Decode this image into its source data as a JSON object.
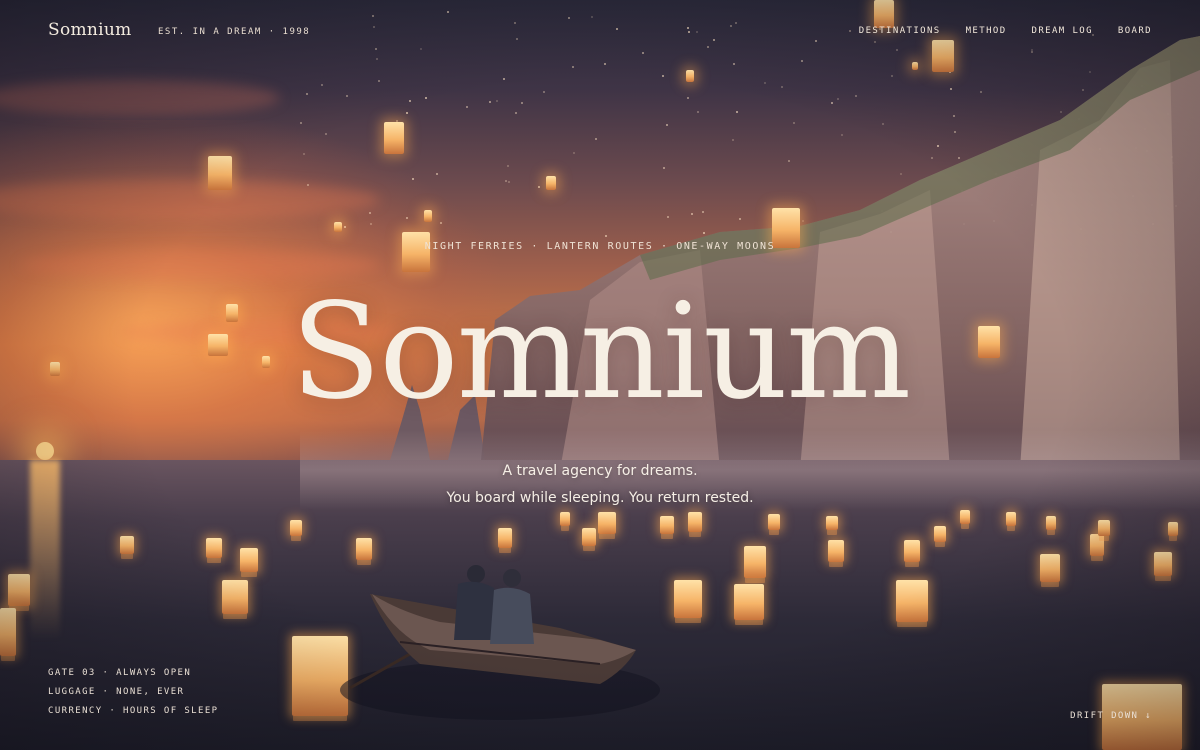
{
  "header": {
    "brand": "Somnium",
    "established": "EST. IN A DREAM · 1998",
    "nav": [
      "DESTINATIONS",
      "METHOD",
      "DREAM LOG",
      "BOARD"
    ]
  },
  "hero": {
    "kicker": "NIGHT FERRIES · LANTERN ROUTES · ONE-WAY MOONS",
    "title": "Somnium",
    "tagline_line1": "A travel agency for dreams.",
    "tagline_line2": "You board while sleeping. You return rested."
  },
  "info": {
    "gate": "GATE 03 · ALWAYS OPEN",
    "luggage": "LUGGAGE · NONE, EVER",
    "currency": "CURRENCY · HOURS OF SLEEP"
  },
  "scroll_cue": "DRIFT DOWN ↓",
  "colors": {
    "text": "#f6efe4",
    "lantern_glow": "#f6b468",
    "sky_top": "#2b2a3b",
    "sunset": "#c97646"
  }
}
